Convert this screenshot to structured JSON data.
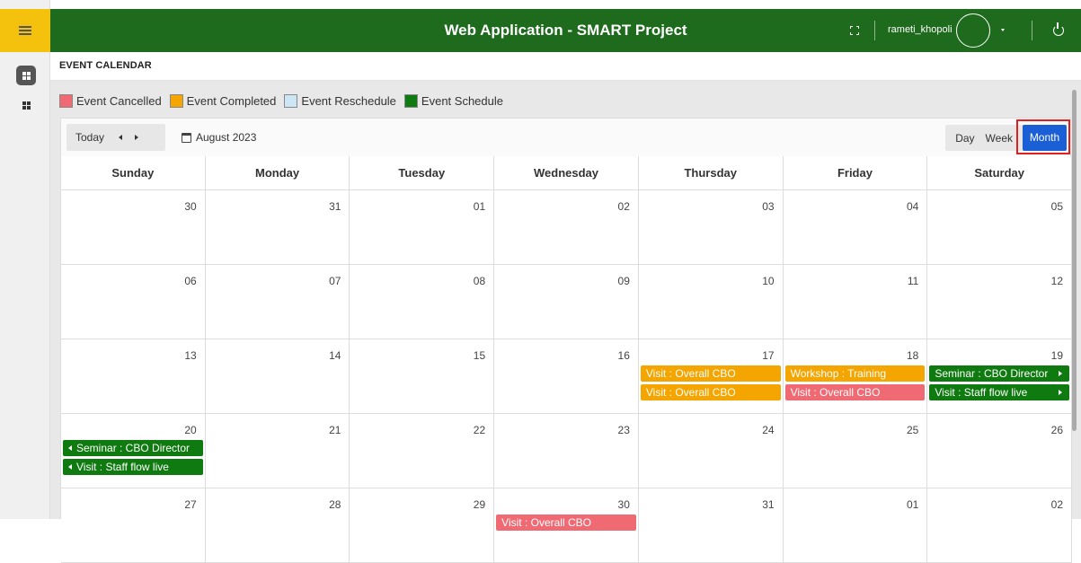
{
  "header": {
    "title": "Web Application - SMART Project",
    "username": "rameti_khopoli"
  },
  "page": {
    "title": "EVENT CALENDAR"
  },
  "legend": [
    {
      "label": "Event Cancelled",
      "color": "#f06a74"
    },
    {
      "label": "Event Completed",
      "color": "#f5a500"
    },
    {
      "label": "Event Reschedule",
      "color": "#cce6f5"
    },
    {
      "label": "Event Schedule",
      "color": "#0f7a0f"
    }
  ],
  "toolbar": {
    "today": "Today",
    "month_label": "August 2023",
    "views": {
      "day": "Day",
      "week": "Week",
      "month": "Month"
    },
    "active_view": "Month"
  },
  "days_of_week": [
    "Sunday",
    "Monday",
    "Tuesday",
    "Wednesday",
    "Thursday",
    "Friday",
    "Saturday"
  ],
  "weeks": [
    [
      "30",
      "31",
      "01",
      "02",
      "03",
      "04",
      "05"
    ],
    [
      "06",
      "07",
      "08",
      "09",
      "10",
      "11",
      "12"
    ],
    [
      "13",
      "14",
      "15",
      "16",
      "17",
      "18",
      "19"
    ],
    [
      "20",
      "21",
      "22",
      "23",
      "24",
      "25",
      "26"
    ],
    [
      "27",
      "28",
      "29",
      "30",
      "31",
      "01",
      "02"
    ]
  ],
  "events": {
    "thu17_a": "Visit : Overall CBO",
    "thu17_b": "Visit : Overall CBO",
    "fri18_a": "Workshop : Training",
    "fri18_b": "Visit : Overall CBO",
    "sat19_a": "Seminar : CBO Director",
    "sat19_b": "Visit : Staff flow live",
    "sun20_a": "Seminar : CBO Director",
    "sun20_b": "Visit : Staff flow live",
    "wed30_a": "Visit : Overall CBO"
  },
  "colors": {
    "header": "#1e6b1e",
    "menu": "#f4c20d",
    "active_view": "#1a5fd6"
  }
}
